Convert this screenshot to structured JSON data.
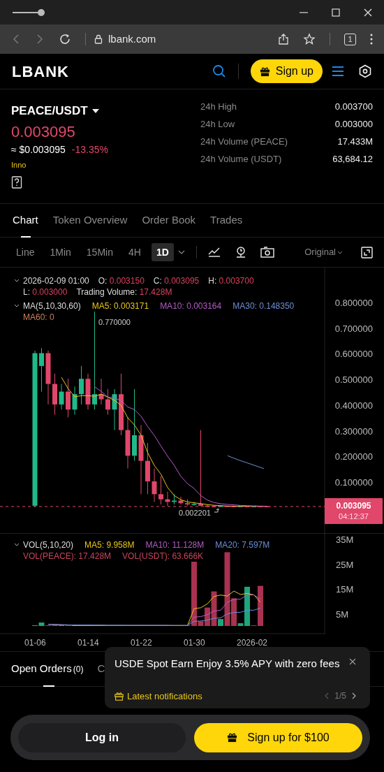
{
  "browser": {
    "url": "lbank.com",
    "tab_count": "1"
  },
  "header": {
    "logo": "LBANK",
    "signup_button": "Sign up"
  },
  "pair": {
    "symbol": "PEACE/USDT",
    "price": "0.003095",
    "usd_price": "≈ $0.003095",
    "change": "-13.35%",
    "tag": "Inno"
  },
  "stats": [
    {
      "label": "24h High",
      "value": "0.003700"
    },
    {
      "label": "24h Low",
      "value": "0.003000"
    },
    {
      "label": "24h Volume (PEACE)",
      "value": "17.433M"
    },
    {
      "label": "24h Volume (USDT)",
      "value": "63,684.12"
    }
  ],
  "tabs": [
    {
      "label": "Chart",
      "selected": true
    },
    {
      "label": "Token Overview",
      "selected": false
    },
    {
      "label": "Order Book",
      "selected": false
    },
    {
      "label": "Trades",
      "selected": false
    }
  ],
  "intervals": [
    {
      "label": "Line",
      "selected": false
    },
    {
      "label": "1Min",
      "selected": false
    },
    {
      "label": "15Min",
      "selected": false
    },
    {
      "label": "4H",
      "selected": false
    },
    {
      "label": "1D",
      "selected": true
    }
  ],
  "price_mode": "Original",
  "chart": {
    "ohlc": {
      "date": "2026-02-09 01:00",
      "items": [
        {
          "label": "O:",
          "value": "0.003150"
        },
        {
          "label": "C:",
          "value": "0.003095"
        },
        {
          "label": "H:",
          "value": "0.003700"
        },
        {
          "label": "L:",
          "value": "0.003000"
        },
        {
          "label": "Trading Volume:",
          "value": "17.428M"
        }
      ]
    },
    "ma": {
      "label": "MA(5,10,30,60)",
      "items": [
        {
          "text": "MA5: 0.003171",
          "color": "#e8c619"
        },
        {
          "text": "MA10: 0.003164",
          "color": "#b45cc8"
        },
        {
          "text": "MA30: 0.148350",
          "color": "#6b8fd6"
        },
        {
          "text": "MA60: 0",
          "color": "#c9805a"
        }
      ]
    },
    "price_axis": [
      "0.800000",
      "0.700000",
      "0.600000",
      "0.500000",
      "0.400000",
      "0.300000",
      "0.200000",
      "0.100000"
    ],
    "max_label": "0.770000",
    "min_label": "0.002201",
    "last_price": "0.003095",
    "countdown": "04:12:37",
    "vol": {
      "label": "VOL(5,10,20)",
      "items": [
        {
          "text": "MA5: 9.958M",
          "color": "#e8c619"
        },
        {
          "text": "MA10: 11.128M",
          "color": "#b45cc8"
        },
        {
          "text": "MA20: 7.597M",
          "color": "#6b8fd6"
        },
        {
          "text": "VOL(PEACE): 17.428M",
          "color": "#c9445f"
        },
        {
          "text": "VOL(USDT): 63.666K",
          "color": "#c9445f"
        }
      ]
    },
    "volume_axis": [
      "35M",
      "25M",
      "15M",
      "5M"
    ],
    "dates": [
      "01-06",
      "01-14",
      "01-22",
      "01-30",
      "2026-02"
    ]
  },
  "orders_tabs": [
    {
      "label": "Open Orders",
      "count": "(0)",
      "selected": true
    },
    {
      "label": "C",
      "selected": false
    }
  ],
  "notification": {
    "title": "USDE Spot Earn Enjoy 3.5% APY with zero fees",
    "link": "Latest notifications",
    "pager": "1/5"
  },
  "buttons": {
    "login": "Log in",
    "signup": "Sign up for $100"
  }
}
